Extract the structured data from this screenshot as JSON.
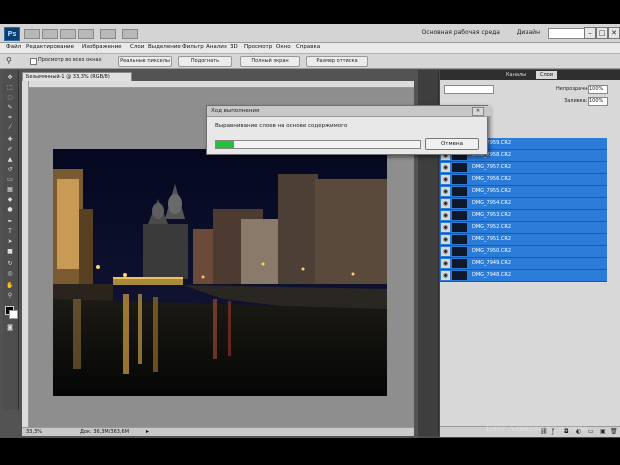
{
  "app": {
    "logo": "Ps",
    "workspace_label": "Основная рабочая среда",
    "design_label": "Дизайн",
    "window_buttons": [
      "–",
      "□",
      "✕"
    ]
  },
  "menu": [
    "Файл",
    "Редактирование",
    "Изображение",
    "Слои",
    "Выделение",
    "Фильтр",
    "Анализ",
    "3D",
    "Просмотр",
    "Окно",
    "Справка"
  ],
  "options": {
    "checkbox_label": "Просмотр во всех окнах",
    "buttons": [
      "Реальные пикселы",
      "Подогнать",
      "Полный экран",
      "Размер оттиска"
    ]
  },
  "document": {
    "tab_label": "Безымянный-1 @ 33,3% (RGB/8)",
    "zoom": "33,3%",
    "status": "Док: 36,3М/363,6М"
  },
  "dialog": {
    "title": "Ход выполнения",
    "message": "Выравнивание слоев на основе содержимого",
    "progress": 0.09,
    "cancel_label": "Отмена",
    "close_label": "✕"
  },
  "layers_panel": {
    "tabs": [
      "Каналы",
      "Слои"
    ],
    "opacity_label": "Непрозрачность:",
    "opacity_value": "100%",
    "fill_label": "Заливка:",
    "fill_value": "100%",
    "layers": [
      "DMG_7959.CR2",
      "DMG_7958.CR2",
      "DMG_7957.CR2",
      "DMG_7956.CR2",
      "DMG_7955.CR2",
      "DMG_7954.CR2",
      "DMG_7953.CR2",
      "DMG_7952.CR2",
      "DMG_7951.CR2",
      "DMG_7950.CR2",
      "DMG_7949.CR2",
      "DMG_7948.CR2"
    ],
    "selected_color": "#2b7bd9"
  },
  "watermark": "Блог Алексея Кузьмина",
  "colors": {
    "progress": "#22c33a",
    "selection": "#2b7bd9"
  }
}
